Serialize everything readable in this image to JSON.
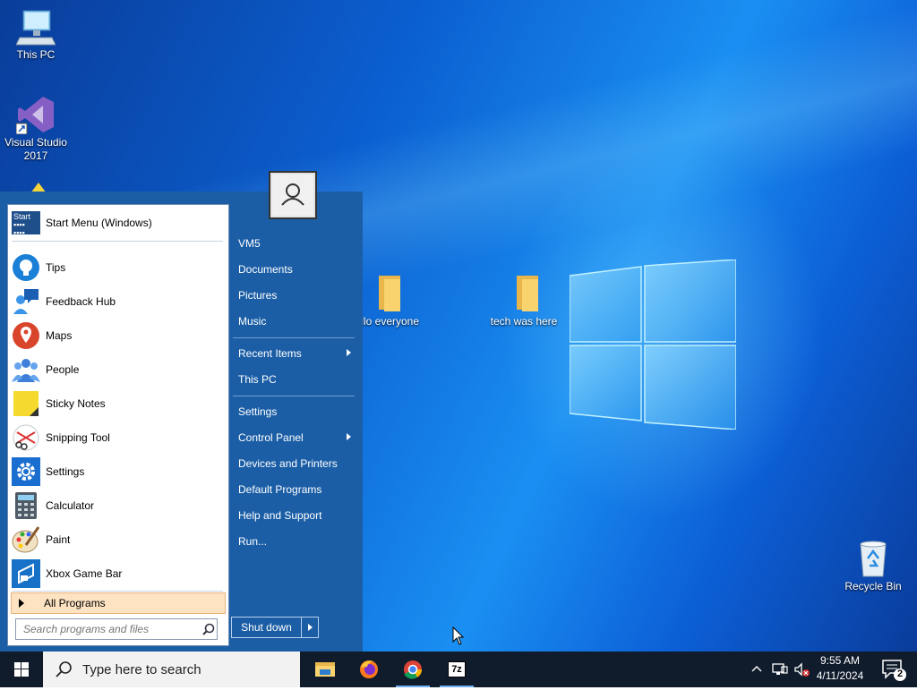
{
  "desktop": {
    "icons": [
      {
        "label": "This PC"
      },
      {
        "label": "Visual Studio 2017"
      },
      {
        "label": "hello everyone"
      },
      {
        "label": "tech was here"
      },
      {
        "label": "Recycle Bin"
      }
    ]
  },
  "start_menu": {
    "pinned": {
      "label": "Start Menu (Windows)"
    },
    "items": [
      {
        "label": "Tips"
      },
      {
        "label": "Feedback Hub"
      },
      {
        "label": "Maps"
      },
      {
        "label": "People"
      },
      {
        "label": "Sticky Notes"
      },
      {
        "label": "Snipping Tool"
      },
      {
        "label": "Settings"
      },
      {
        "label": "Calculator"
      },
      {
        "label": "Paint"
      },
      {
        "label": "Xbox Game Bar"
      }
    ],
    "all_programs": "All Programs",
    "search_placeholder": "Search programs and files",
    "right": {
      "items": [
        {
          "label": "VM5"
        },
        {
          "label": "Documents"
        },
        {
          "label": "Pictures"
        },
        {
          "label": "Music"
        },
        {
          "label": "Recent Items"
        },
        {
          "label": "This PC"
        },
        {
          "label": "Settings"
        },
        {
          "label": "Control Panel"
        },
        {
          "label": "Devices and Printers"
        },
        {
          "label": "Default Programs"
        },
        {
          "label": "Help and Support"
        },
        {
          "label": "Run..."
        }
      ]
    },
    "shutdown": "Shut down"
  },
  "taskbar": {
    "search_text": "Type here to search",
    "apps": [
      {
        "name": "file-explorer-icon"
      },
      {
        "name": "firefox-icon"
      },
      {
        "name": "chrome-icon"
      },
      {
        "name": "7zip-icon",
        "label": "7z"
      }
    ],
    "clock": {
      "time": "9:55 AM",
      "date": "4/11/2024"
    },
    "notifications": "2"
  },
  "colors": {
    "start_blue": "#1b5ea6",
    "taskbar": "#101c2c",
    "highlight": "#fde3c2"
  }
}
